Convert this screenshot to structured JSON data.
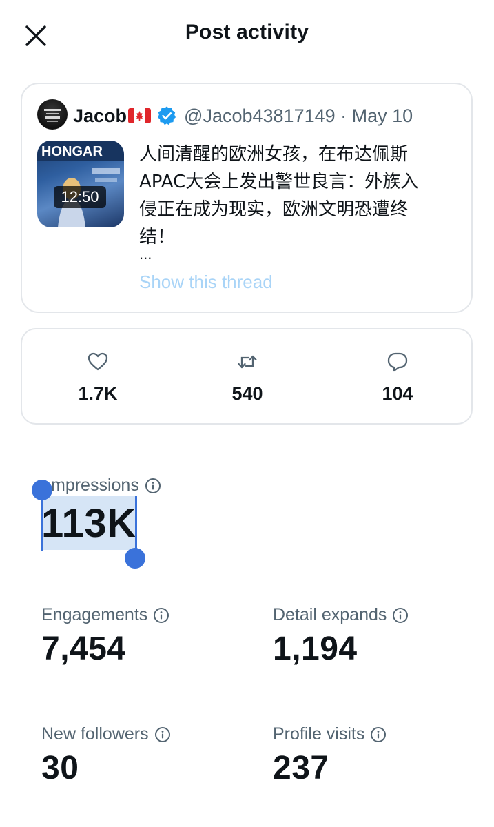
{
  "header": {
    "title": "Post activity",
    "close_icon": "close-icon"
  },
  "post": {
    "author_name": "Jacob",
    "flag_icon": "canada-flag-icon",
    "verified_icon": "verified-badge-icon",
    "handle_date": "@Jacob43817149 · May 10",
    "video_duration": "12:50",
    "text": "人间清醒的欧洲女孩，在布达佩斯\nAPAC大会上发出警世良言：外族入\n侵正在成为现实，欧洲文明恐遭终\n结！",
    "ellipsis": "...",
    "show_thread": "Show this thread"
  },
  "metrics": {
    "likes": "1.7K",
    "reposts": "540",
    "replies": "104"
  },
  "stats": {
    "impressions_label": "mpressions",
    "impressions_value": "113K",
    "engagements_label": "Engagements",
    "engagements_value": "7,454",
    "detail_expands_label": "Detail expands",
    "detail_expands_value": "1,194",
    "new_followers_label": "New followers",
    "new_followers_value": "30",
    "profile_visits_label": "Profile visits",
    "profile_visits_value": "237"
  },
  "colors": {
    "text_primary": "#0f1419",
    "text_secondary": "#536471",
    "link_light_blue": "#a9d4f7",
    "selection_blue": "#3a72da",
    "border": "#e3e6ea",
    "verified_blue": "#1d9bf0"
  }
}
